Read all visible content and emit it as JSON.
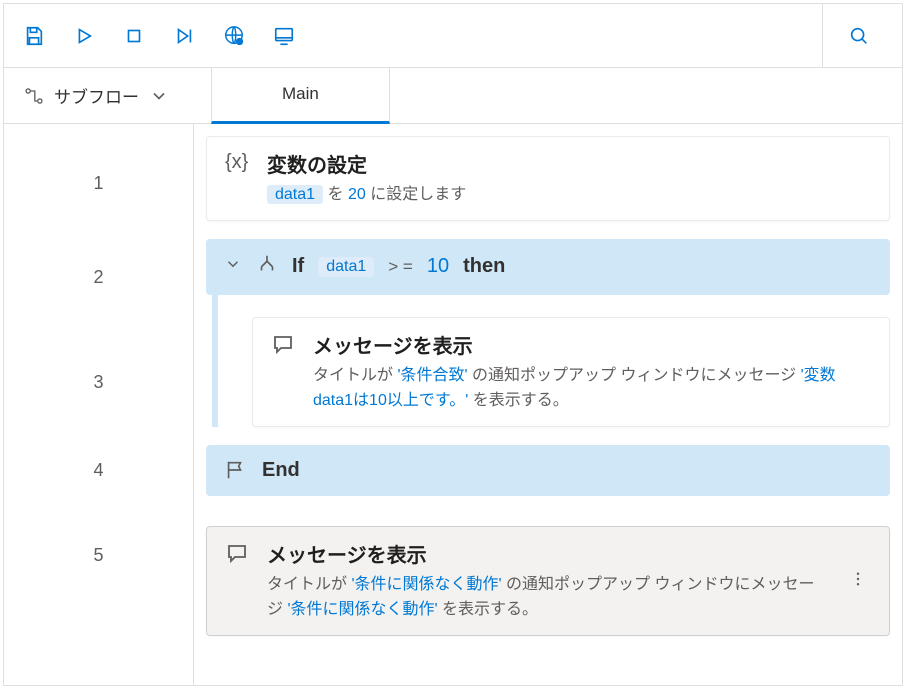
{
  "toolbar": {
    "icons": [
      "save",
      "play",
      "stop",
      "step",
      "web",
      "screen"
    ],
    "search": "search"
  },
  "tabbar": {
    "subflow_label": "サブフロー",
    "main_tab": "Main"
  },
  "lines": [
    "1",
    "2",
    "3",
    "4",
    "5"
  ],
  "actions": {
    "set_var": {
      "title": "変数の設定",
      "var": "data1",
      "mid": " を ",
      "value": "20",
      "tail": " に設定します"
    },
    "if": {
      "kw_if": "If",
      "var": "data1",
      "op": "> =",
      "val": "10",
      "kw_then": "then"
    },
    "msg1": {
      "title": "メッセージを表示",
      "p1": "タイトルが ",
      "t1": "'条件合致'",
      "p2": " の通知ポップアップ ウィンドウにメッセージ ",
      "t2": "'変数data1は10以上です。'",
      "p3": " を表示する。"
    },
    "end": {
      "label": "End"
    },
    "msg2": {
      "title": "メッセージを表示",
      "p1": "タイトルが ",
      "t1": "'条件に関係なく動作'",
      "p2": " の通知ポップアップ ウィンドウにメッセージ ",
      "t2": "'条件に関係なく動作'",
      "p3": " を表示する。"
    }
  }
}
